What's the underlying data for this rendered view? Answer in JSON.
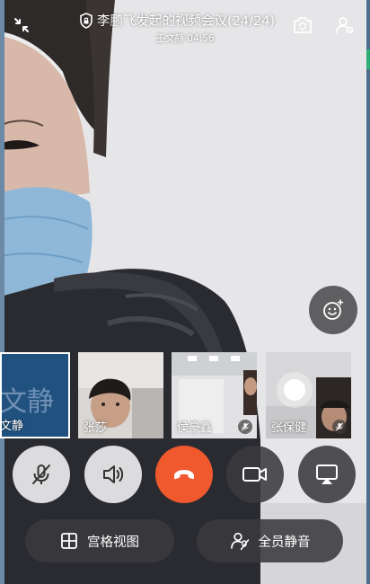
{
  "meeting": {
    "title": "李鹏飞发起的视频会议(24/24)",
    "subtitle": "王文静 04:56"
  },
  "participants": [
    {
      "name": "文静",
      "tile_text": "文静",
      "muted": false,
      "color": "#21527f"
    },
    {
      "name": "张莎",
      "muted": false
    },
    {
      "name": "侯豪鑫",
      "muted": true
    },
    {
      "name": "张保健",
      "muted": true
    }
  ],
  "controls": {
    "view_label": "宫格视图",
    "mute_all_label": "全员静音"
  },
  "colors": {
    "hangup": "#f0582e",
    "active_tile_border": "#ffffff"
  }
}
